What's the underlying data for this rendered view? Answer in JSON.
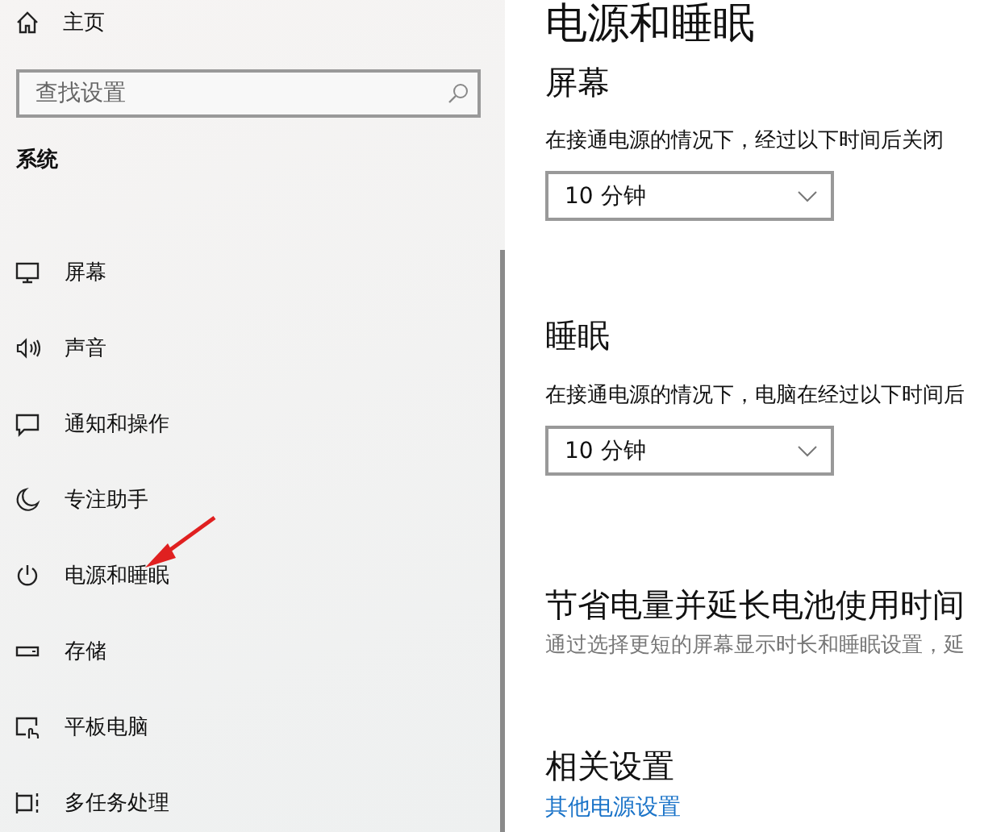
{
  "sidebar": {
    "home": {
      "label": "主页"
    },
    "search": {
      "placeholder": "查找设置"
    },
    "section": "系统",
    "items": [
      {
        "label": "屏幕"
      },
      {
        "label": "声音"
      },
      {
        "label": "通知和操作"
      },
      {
        "label": "专注助手"
      },
      {
        "label": "电源和睡眠"
      },
      {
        "label": "存储"
      },
      {
        "label": "平板电脑"
      },
      {
        "label": "多任务处理"
      }
    ]
  },
  "page": {
    "title": "电源和睡眠",
    "sections": [
      {
        "kind": "dropdown",
        "heading": "屏幕",
        "description": "在接通电源的情况下，经过以下时间后关闭",
        "value": "10 分钟"
      },
      {
        "kind": "dropdown",
        "heading": "睡眠",
        "description": "在接通电源的情况下，电脑在经过以下时间后",
        "value": "10 分钟"
      },
      {
        "kind": "info",
        "heading": "节省电量并延长电池使用时间",
        "description": "通过选择更短的屏幕显示时长和睡眠设置，延"
      },
      {
        "kind": "links",
        "heading": "相关设置",
        "links": [
          "其他电源设置"
        ]
      }
    ]
  }
}
